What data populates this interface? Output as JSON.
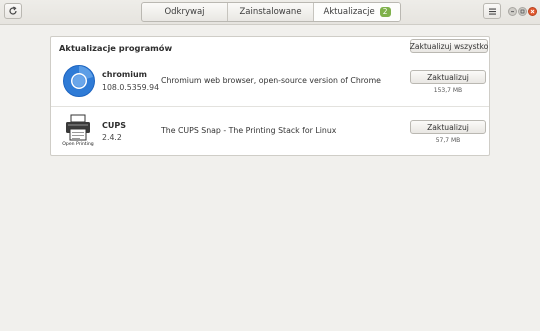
{
  "toolbar": {
    "tabs": [
      {
        "label": "Odkrywaj"
      },
      {
        "label": "Zainstalowane"
      },
      {
        "label": "Aktualizacje",
        "badge": "2"
      }
    ]
  },
  "updates": {
    "title": "Aktualizacje programów",
    "update_all_label": "Zaktualizuj wszystko",
    "items": [
      {
        "name": "chromium",
        "version": "108.0.5359.94",
        "description": "Chromium web browser, open-source version of Chrome",
        "button": "Zaktualizuj",
        "size": "153,7 MB",
        "icon": "chromium-icon"
      },
      {
        "name": "CUPS",
        "version": "2.4.2",
        "description": "The CUPS Snap - The Printing Stack for Linux",
        "button": "Zaktualizuj",
        "size": "57,7 MB",
        "icon": "cups-printer-icon",
        "icon_caption": "Open Printing"
      }
    ]
  },
  "colors": {
    "badge": "#7fb14b",
    "close": "#e25a31"
  }
}
